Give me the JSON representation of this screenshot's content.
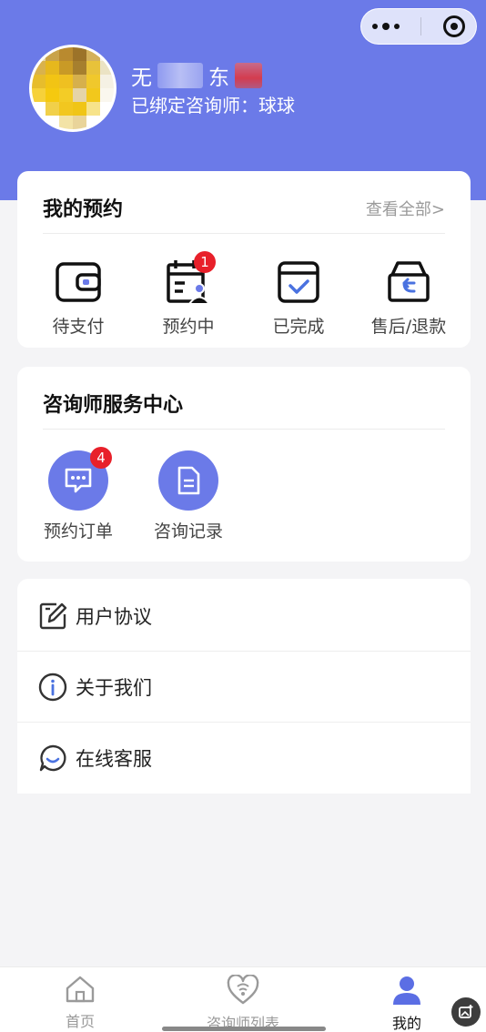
{
  "profile": {
    "name_visible_1": "无",
    "name_visible_2": "东",
    "bound_consultant": "已绑定咨询师：球球"
  },
  "appointments": {
    "title": "我的预约",
    "view_all": "查看全部>",
    "items": [
      {
        "label": "待支付",
        "icon": "wallet-icon",
        "badge": null
      },
      {
        "label": "预约中",
        "icon": "calendar-person-icon",
        "badge": "1"
      },
      {
        "label": "已完成",
        "icon": "calendar-check-icon",
        "badge": null
      },
      {
        "label": "售后/退款",
        "icon": "return-box-icon",
        "badge": null
      }
    ]
  },
  "service_center": {
    "title": "咨询师服务中心",
    "items": [
      {
        "label": "预约订单",
        "icon": "chat-bubble-icon",
        "badge": "4"
      },
      {
        "label": "咨询记录",
        "icon": "document-icon",
        "badge": null
      }
    ]
  },
  "menu": {
    "items": [
      {
        "label": "用户协议",
        "icon": "edit-icon"
      },
      {
        "label": "关于我们",
        "icon": "info-icon"
      },
      {
        "label": "在线客服",
        "icon": "chat-service-icon"
      }
    ]
  },
  "tabbar": {
    "tabs": [
      {
        "label": "首页",
        "icon": "home-icon",
        "active": false
      },
      {
        "label": "咨询师列表",
        "icon": "heart-stethoscope-icon",
        "active": false
      },
      {
        "label": "我的",
        "icon": "user-icon",
        "active": true
      }
    ]
  },
  "colors": {
    "accent": "#6b7ae8",
    "badge": "#e8202a"
  }
}
